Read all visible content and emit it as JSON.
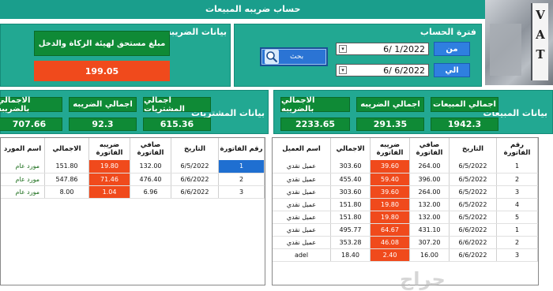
{
  "title": "حساب ضريبه المبيعات",
  "period": {
    "label": "فترة الحساب",
    "from_label": "من",
    "to_label": "الي",
    "from_value": "6/  1/2022",
    "to_value": "6/  6/2022",
    "search_label": "بحث"
  },
  "tax": {
    "label": "بيانات الضريبه",
    "due_label": "مبلغ مستحق لهيئة الزكاة والدخل",
    "due_value": "199.05"
  },
  "sales": {
    "label": "بيانات المبيعات",
    "total_sales_label": "اجمالي المبيعات",
    "total_tax_label": "اجمالي الضريبه",
    "total_incl_label": "الاجمالي بالضريبه",
    "total_sales": "1942.3",
    "total_tax": "291.35",
    "total_incl": "2233.65",
    "columns": [
      "رقم الفاتورة",
      "التاريخ",
      "صافي الفاتورة",
      "ضريبه الفاتورة",
      "الاجمالي",
      "اسم العميل"
    ],
    "rows": [
      {
        "no": "1",
        "date": "6/5/2022",
        "net": "264.00",
        "tax": "39.60",
        "total": "303.60",
        "name": "عميل نقدي"
      },
      {
        "no": "2",
        "date": "6/5/2022",
        "net": "396.00",
        "tax": "59.40",
        "total": "455.40",
        "name": "عميل نقدي"
      },
      {
        "no": "3",
        "date": "6/5/2022",
        "net": "264.00",
        "tax": "39.60",
        "total": "303.60",
        "name": "عميل نقدي"
      },
      {
        "no": "4",
        "date": "6/5/2022",
        "net": "132.00",
        "tax": "19.80",
        "total": "151.80",
        "name": "عميل نقدي"
      },
      {
        "no": "5",
        "date": "6/5/2022",
        "net": "132.00",
        "tax": "19.80",
        "total": "151.80",
        "name": "عميل نقدي"
      },
      {
        "no": "1",
        "date": "6/6/2022",
        "net": "431.10",
        "tax": "64.67",
        "total": "495.77",
        "name": "عميل نقدي"
      },
      {
        "no": "2",
        "date": "6/6/2022",
        "net": "307.20",
        "tax": "46.08",
        "total": "353.28",
        "name": "عميل نقدي"
      },
      {
        "no": "3",
        "date": "6/6/2022",
        "net": "16.00",
        "tax": "2.40",
        "total": "18.40",
        "name": "adel"
      }
    ]
  },
  "purchases": {
    "label": "بيانات المشتريات",
    "total_purch_label": "اجمالي المشتريات",
    "total_tax_label": "اجمالي الضريبه",
    "total_incl_label": "الاجمالي بالضريبه",
    "total_purch": "615.36",
    "total_tax": "92.3",
    "total_incl": "707.66",
    "columns": [
      "رقم الفاتورة",
      "التاريخ",
      "صافي الفاتورة",
      "ضريبه الفاتورة",
      "الاجمالي",
      "اسم المورد"
    ],
    "rows": [
      {
        "no": "1",
        "date": "6/5/2022",
        "net": "132.00",
        "tax": "19.80",
        "total": "151.80",
        "name": "مورد عام"
      },
      {
        "no": "2",
        "date": "6/6/2022",
        "net": "476.40",
        "tax": "71.46",
        "total": "547.86",
        "name": "مورد عام"
      },
      {
        "no": "3",
        "date": "6/6/2022",
        "net": "6.96",
        "tax": "1.04",
        "total": "8.00",
        "name": "مورد عام"
      }
    ]
  },
  "watermark": "حراج",
  "vat_letters": [
    "V",
    "A",
    "T"
  ],
  "colors": {
    "panel": "#22a892",
    "green": "#0f8a36",
    "orange": "#f04a1c",
    "blue": "#2f7fe0",
    "titlebar": "#1a9e8c"
  }
}
